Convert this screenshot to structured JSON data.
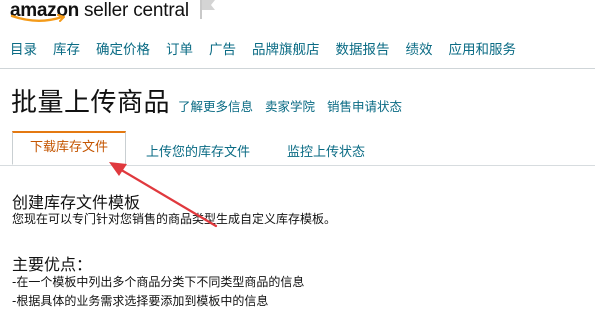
{
  "header": {
    "logo_bold": "amazon",
    "logo_rest": "seller central",
    "logo_icon": "amazon-smile-icon",
    "flag_icon": "flag-icon"
  },
  "nav": {
    "items": [
      {
        "label": "目录"
      },
      {
        "label": "库存"
      },
      {
        "label": "确定价格"
      },
      {
        "label": "订单"
      },
      {
        "label": "广告"
      },
      {
        "label": "品牌旗舰店"
      },
      {
        "label": "数据报告"
      },
      {
        "label": "绩效"
      },
      {
        "label": "应用和服务"
      }
    ]
  },
  "page": {
    "title": "批量上传商品",
    "links": [
      {
        "label": "了解更多信息"
      },
      {
        "label": "卖家学院"
      },
      {
        "label": "销售申请状态"
      }
    ]
  },
  "tabs": [
    {
      "label": "下载库存文件",
      "active": true
    },
    {
      "label": "上传您的库存文件",
      "active": false
    },
    {
      "label": "监控上传状态",
      "active": false
    }
  ],
  "content": {
    "heading": "创建库存文件模板",
    "description": "您现在可以专门针对您销售的商品类型生成自定义库存模板。",
    "advantages_heading": "主要优点：",
    "advantages": [
      "-在一个模板中列出多个商品分类下不同类型商品的信息",
      "-根据具体的业务需求选择要添加到模板中的信息"
    ]
  },
  "colors": {
    "link": "#0a6b84",
    "active_tab_text": "#c45500",
    "active_tab_border": "#e47911",
    "annotation_arrow": "#e0393e"
  },
  "annotation": {
    "icon": "red-arrow-icon"
  }
}
